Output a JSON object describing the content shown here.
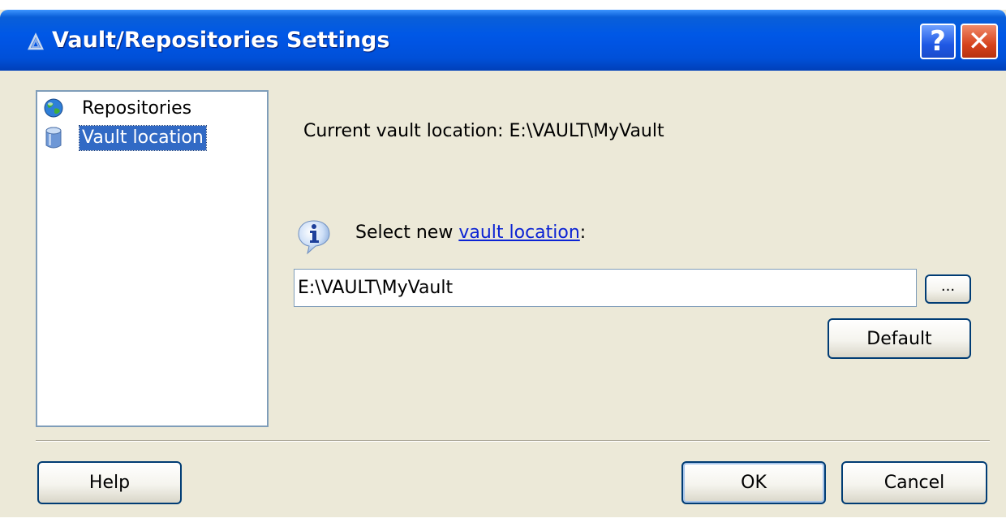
{
  "window": {
    "title": "Vault/Repositories Settings",
    "help_button": "?",
    "close_button": "✕"
  },
  "nav": {
    "items": [
      {
        "label": "Repositories",
        "icon": "globe-icon",
        "selected": false
      },
      {
        "label": "Vault location",
        "icon": "vault-cylinder-icon",
        "selected": true
      }
    ]
  },
  "main": {
    "current_location_label": "Current vault location: ",
    "current_location_value": "E:\\VAULT\\MyVault",
    "select_prefix": "Select new ",
    "select_link": "vault location",
    "select_suffix": ":",
    "path_value": "E:\\VAULT\\MyVault",
    "browse_label": "...",
    "default_label": "Default"
  },
  "footer": {
    "help_label": "Help",
    "ok_label": "OK",
    "cancel_label": "Cancel"
  },
  "colors": {
    "titlebar": "#0054e3",
    "selection": "#316ac5",
    "link": "#0b23d4",
    "dialog_bg": "#ece9d8"
  }
}
